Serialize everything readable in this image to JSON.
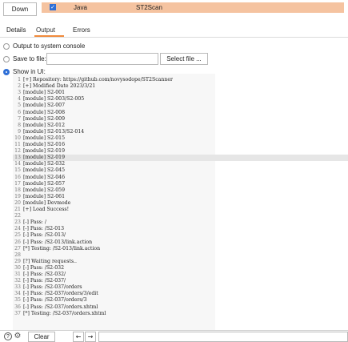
{
  "top": {
    "down_label": "Down",
    "extension": {
      "checked": true,
      "type": "Java",
      "name": "ST2Scan",
      "row_color": "#f5c3a0"
    }
  },
  "tabs": [
    {
      "label": "Details"
    },
    {
      "label": "Output",
      "active": true
    },
    {
      "label": "Errors"
    }
  ],
  "output": {
    "options": [
      {
        "label": "Output to system console",
        "selected": false
      },
      {
        "label": "Save to file:",
        "selected": false
      },
      {
        "label": "Show in UI:",
        "selected": true
      }
    ],
    "file_value": "",
    "select_file_label": "Select file ..."
  },
  "console": {
    "highlighted_line": 13,
    "lines": [
      "[+] Repository: https://github.com/novysodope/ST2Scanner",
      "[+] Modified Date 2023/3/21",
      "[module] S2-001",
      "[module] S2-003/S2-005",
      "[module] S2-007",
      "[module] S2-008",
      "[module] S2-009",
      "[module] S2-012",
      "[module] S2-013/S2-014",
      "[module] S2-015",
      "[module] S2-016",
      "[module] S2-019",
      "[module] S2-019",
      "[module] S2-032",
      "[module] S2-045",
      "[module] S2-046",
      "[module] S2-057",
      "[module] S2-059",
      "[module] S2-061",
      "[module] Devmode",
      "[+] Load Success!",
      "",
      "[-] Pass: /",
      "[-] Pass: /S2-013",
      "[-] Pass: /S2-013/",
      "[-] Pass: /S2-013/link.action",
      "[*] Testing: /S2-013/link.action",
      "",
      "[?] Waiting requests..",
      "[-] Pass: /S2-032",
      "[-] Pass: /S2-032/",
      "[-] Pass: /S2-037/",
      "[-] Pass: /S2-037/orders",
      "[-] Pass: /S2-037/orders/3/edit",
      "[-] Pass: /S2-037/orders/3",
      "[-] Pass: /S2-037/orders.xhtml",
      "[*] Testing: /S2-037/orders.xhtml"
    ]
  },
  "bottom": {
    "help_icon": "help-icon",
    "gear_icon": "gear-icon",
    "clear_label": "Clear",
    "back_glyph": "←",
    "forward_glyph": "→",
    "search_value": ""
  }
}
